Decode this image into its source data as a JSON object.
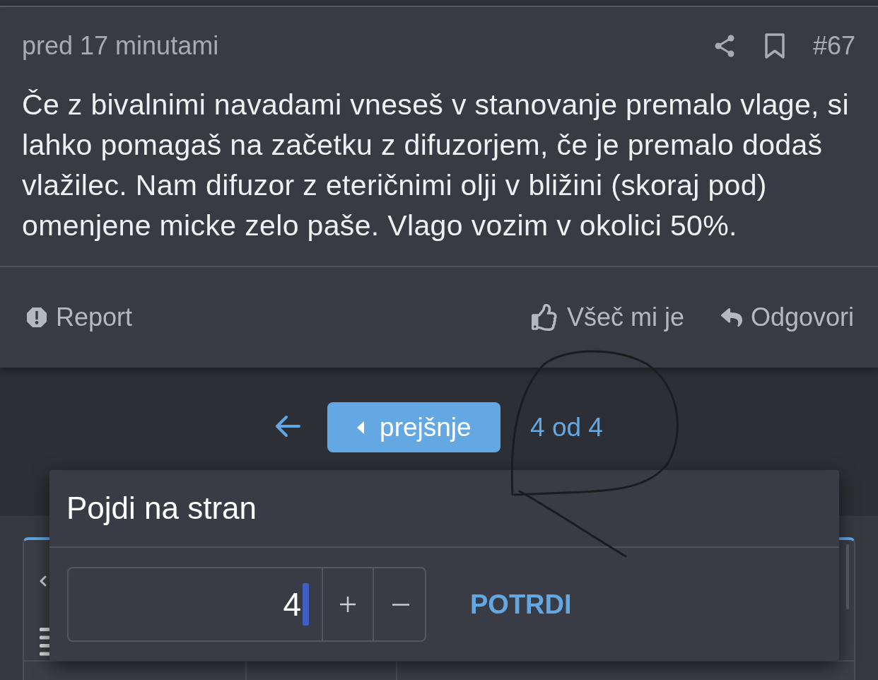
{
  "post": {
    "time": "pred 17 minutami",
    "number": "#67",
    "body": "Če z bivalnimi navadami vneseš v stanovanje premalo vlage, si lahko pomagaš na začetku z difuzorjem, če je premalo dodaš vlažilec. Nam difuzor z eteričnimi olji v bližini (skoraj pod) omenjene micke zelo paše. Vlago vozim v okolici 50%.",
    "report": {
      "kind": "report",
      "label": "Report"
    },
    "actions": [
      {
        "kind": "like",
        "label": "Všeč mi je"
      },
      {
        "kind": "reply",
        "label": "Odgovori"
      }
    ]
  },
  "pagination": {
    "previous_label": "prejšnje",
    "page_info": "4 od 4"
  },
  "goto_dialog": {
    "title": "Pojdi na stran",
    "page_field": {
      "value": "4",
      "focused": true
    },
    "confirm_label": "POTRDI"
  }
}
